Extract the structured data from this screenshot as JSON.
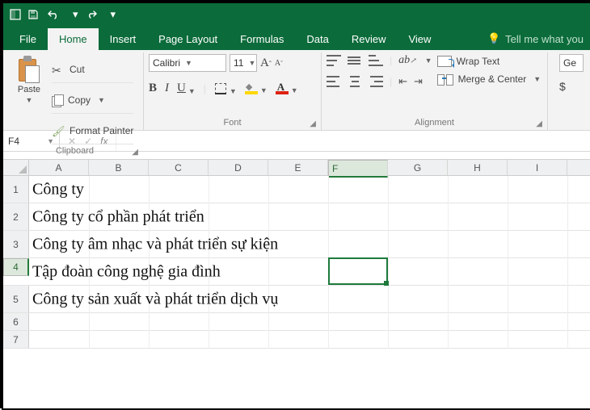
{
  "qat": {
    "save": "save",
    "undo": "undo",
    "redo": "redo"
  },
  "tabs": {
    "file": "File",
    "home": "Home",
    "insert": "Insert",
    "pagelayout": "Page Layout",
    "formulas": "Formulas",
    "data": "Data",
    "review": "Review",
    "view": "View",
    "tellme": "Tell me what you"
  },
  "clipboard": {
    "paste": "Paste",
    "cut": "Cut",
    "copy": "Copy",
    "formatpainter": "Format Painter",
    "group": "Clipboard"
  },
  "font": {
    "name": "Calibri",
    "size": "11",
    "group": "Font",
    "bold": "B",
    "italic": "I",
    "underline": "U"
  },
  "alignment": {
    "wrap": "Wrap Text",
    "merge": "Merge & Center",
    "group": "Alignment"
  },
  "number": {
    "general": "Ge"
  },
  "fbar": {
    "name": "F4",
    "cancel": "✕",
    "enter": "✓",
    "fx": "fx"
  },
  "columns": [
    "A",
    "B",
    "C",
    "D",
    "E",
    "F",
    "G",
    "H",
    "I"
  ],
  "rowdata": {
    "r1": "Công ty",
    "r2": "Công ty cổ phần phát triển",
    "r3": "Công ty âm nhạc và phát triển sự kiện",
    "r4": "Tập đoàn công nghệ gia đình",
    "r5": "Công ty sản xuất và phát triển dịch vụ"
  },
  "selected": {
    "col": "F",
    "row": "4"
  },
  "chart_data": null
}
